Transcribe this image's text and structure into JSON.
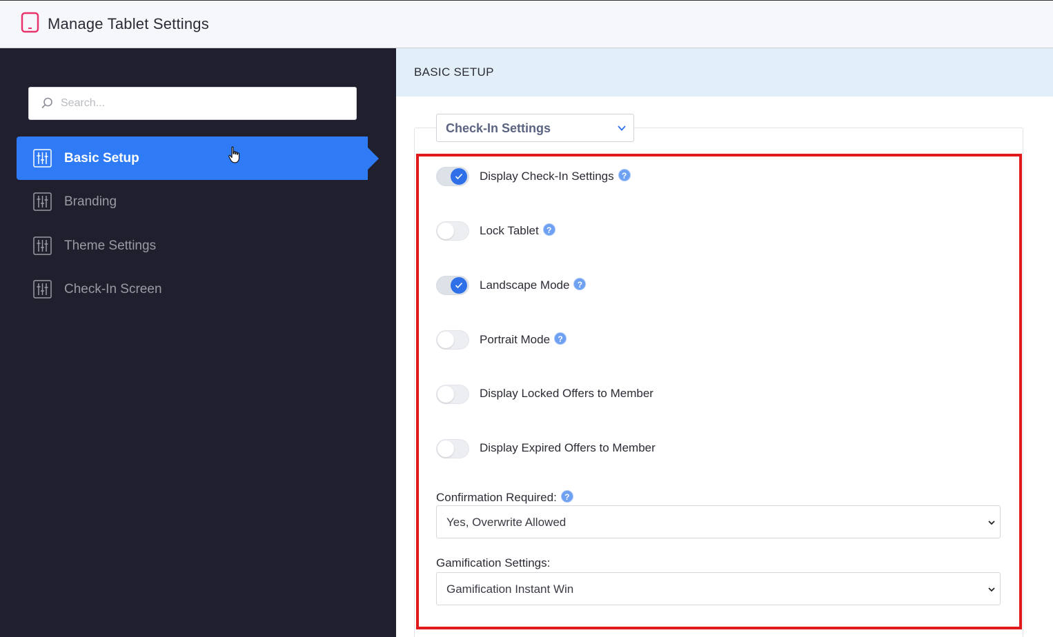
{
  "header": {
    "title": "Manage Tablet Settings",
    "icon": "tablet-icon"
  },
  "sidebar": {
    "search": {
      "placeholder": "Search..."
    },
    "items": [
      {
        "label": "Basic Setup",
        "active": true,
        "icon": "sliders-icon"
      },
      {
        "label": "Branding",
        "active": false,
        "icon": "sliders-icon"
      },
      {
        "label": "Theme Settings",
        "active": false,
        "icon": "sliders-icon"
      },
      {
        "label": "Check-In Screen",
        "active": false,
        "icon": "sliders-icon"
      }
    ]
  },
  "main": {
    "section_title": "BASIC SETUP",
    "group_select": {
      "value": "Check-In Settings"
    },
    "toggles": [
      {
        "label": "Display Check-In Settings",
        "on": true,
        "help": true
      },
      {
        "label": "Lock Tablet",
        "on": false,
        "help": true
      },
      {
        "label": "Landscape Mode",
        "on": true,
        "help": true
      },
      {
        "label": "Portrait Mode",
        "on": false,
        "help": true
      },
      {
        "label": "Display Locked Offers to Member",
        "on": false,
        "help": false
      },
      {
        "label": "Display Expired Offers to Member",
        "on": false,
        "help": false
      }
    ],
    "confirmation": {
      "label": "Confirmation Required:",
      "value": "Yes, Overwrite Allowed",
      "help": true
    },
    "gamification": {
      "label": "Gamification Settings:",
      "value": "Gamification Instant Win"
    }
  },
  "colors": {
    "accent": "#2f7af5",
    "sidebar_bg": "#1f1f2e",
    "highlight": "#e01a1a",
    "header_icon": "#e8336d",
    "section_bg": "#e3eff8"
  }
}
